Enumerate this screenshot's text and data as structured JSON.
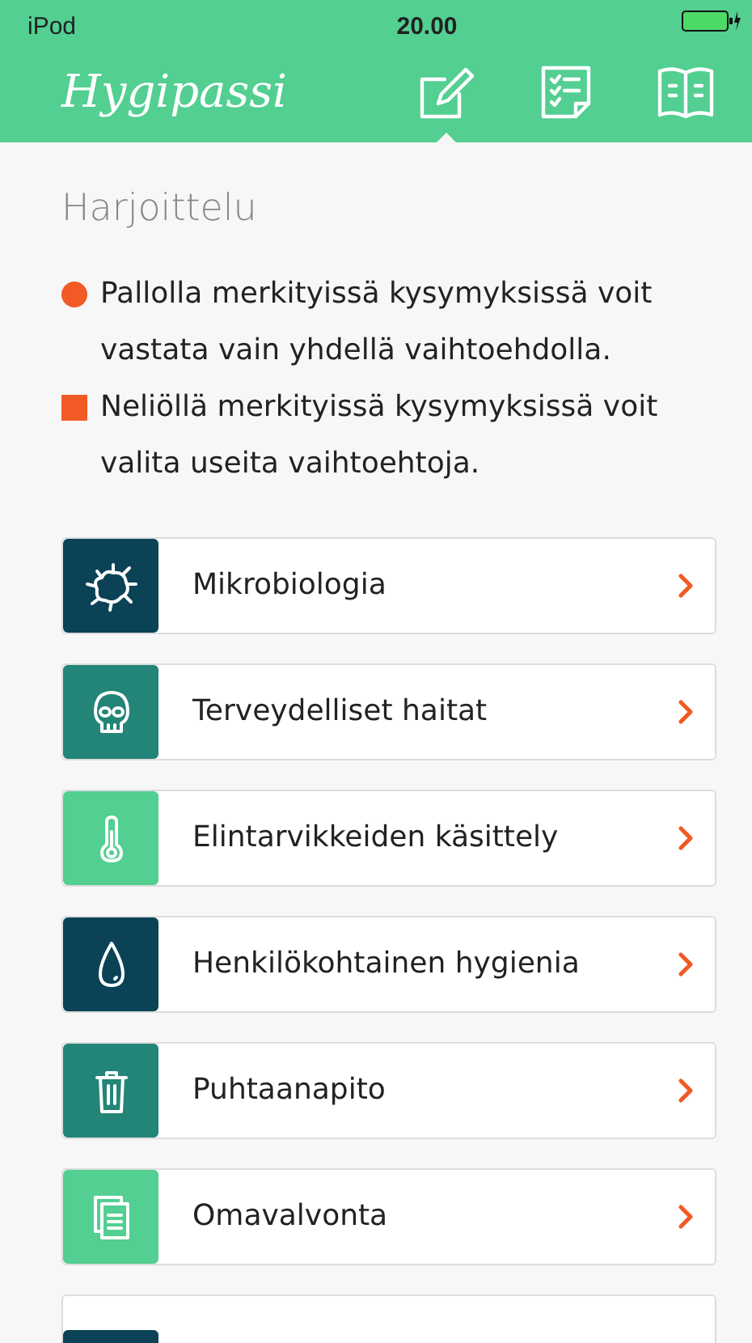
{
  "status_bar": {
    "device": "iPod",
    "time": "20.00"
  },
  "header": {
    "logo": "Hygipassi",
    "tabs": [
      {
        "selected": true
      },
      {
        "selected": false
      },
      {
        "selected": false
      }
    ]
  },
  "title": "Harjoittelu",
  "notes": [
    {
      "kind": "circle",
      "text": "Pallolla merkityissä kysymyksissä voit vastata vain yhdellä vaihtoehdolla."
    },
    {
      "kind": "square",
      "text": "Neliöllä merkityissä kysymyksissä voit valita useita vaihtoehtoja."
    }
  ],
  "topics": [
    {
      "label": "Mikrobiologia",
      "color": "#0b4256"
    },
    {
      "label": "Terveydelliset haitat",
      "color": "#238578"
    },
    {
      "label": "Elintarvikkeiden käsittely",
      "color": "#52cf91"
    },
    {
      "label": "Henkilökohtainen hygienia",
      "color": "#0b4256"
    },
    {
      "label": "Puhtaanapito",
      "color": "#238578"
    },
    {
      "label": "Omavalvonta",
      "color": "#52cf91"
    },
    {
      "color": "#0b4256"
    }
  ]
}
